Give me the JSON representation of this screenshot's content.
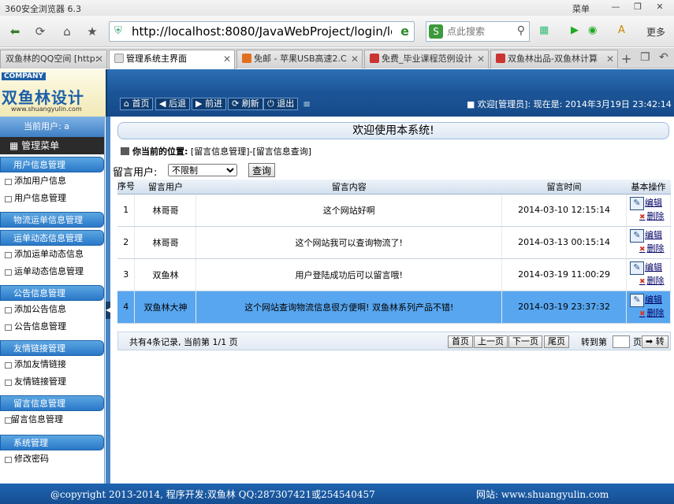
{
  "browser": {
    "title": "360安全浏览器 6.3",
    "menu_label": "菜单",
    "url": "http://localhost:8080/JavaWebProject/login/lo",
    "search_placeholder": "点此搜索",
    "more_label": "更多",
    "tabs": [
      {
        "label": "双鱼林的QQ空间 [http:"
      },
      {
        "label": "管理系统主界面"
      },
      {
        "label": "免邮 - 苹果USB高速2.C"
      },
      {
        "label": "免费_毕业课程范例设计"
      },
      {
        "label": "双鱼林出品-双鱼林计算"
      }
    ]
  },
  "header": {
    "company": "COMPANY",
    "brand": "双鱼林设计",
    "site": "www.shuangyulin.com",
    "nav": [
      {
        "label": "首页"
      },
      {
        "label": "后退"
      },
      {
        "label": "前进"
      },
      {
        "label": "刷新"
      },
      {
        "label": "退出"
      }
    ],
    "welcome": "■ 欢迎[管理员]:  现在是: 2014年3月19日 23:42:14"
  },
  "sidebar": {
    "current_user": "当前用户: a",
    "menu_title": "管理菜单",
    "groups": [
      {
        "title": "用户信息管理",
        "items": [
          "添加用户信息",
          "用户信息管理"
        ]
      },
      {
        "title": "物流运单信息管理",
        "items": []
      },
      {
        "title": "运单动态信息管理",
        "items": [
          "添加运单动态信息",
          "运单动态信息管理"
        ]
      },
      {
        "title": "公告信息管理",
        "items": [
          "添加公告信息",
          "公告信息管理"
        ]
      },
      {
        "title": "友情链接管理",
        "items": [
          "添加友情链接",
          "友情链接管理"
        ]
      },
      {
        "title": "留言信息管理",
        "items": [
          "留言信息管理"
        ]
      },
      {
        "title": "系统管理",
        "items": [
          "修改密码"
        ]
      }
    ]
  },
  "main": {
    "banner": "欢迎使用本系统!",
    "location_label": "你当前的位置:",
    "location_path": "[留言信息管理]-[留言信息查询]",
    "filter_label": "留言用户:",
    "filter_value": "不限制",
    "query_button": "查询",
    "columns": [
      "序号",
      "留言用户",
      "留言内容",
      "留言时间",
      "基本操作"
    ],
    "rows": [
      {
        "no": "1",
        "user": "林哥哥",
        "content": "这个网站好啊",
        "time": "2014-03-10 12:15:14"
      },
      {
        "no": "2",
        "user": "林哥哥",
        "content": "这个网站我可以查询物流了!",
        "time": "2014-03-13 00:15:14"
      },
      {
        "no": "3",
        "user": "双鱼林",
        "content": "用户登陆成功后可以留言哦!",
        "time": "2014-03-19 11:00:29"
      },
      {
        "no": "4",
        "user": "双鱼林大神",
        "content": "这个网站查询物流信息很方便啊! 双鱼林系列产品不错!",
        "time": "2014-03-19 23:37:32"
      }
    ],
    "edit_label": "编辑",
    "delete_label": "删除",
    "pager": {
      "info": "共有4条记录, 当前第 1/1 页",
      "first": "首页",
      "prev": "上一页",
      "next": "下一页",
      "last": "尾页",
      "goto_label": "转到第",
      "page_label": "页",
      "go": "➡ 转"
    }
  },
  "footer": {
    "copyright": "@copyright 2013-2014, 程序开发:双鱼林  QQ:287307421或254540457",
    "site": "网站: www.shuangyulin.com"
  }
}
